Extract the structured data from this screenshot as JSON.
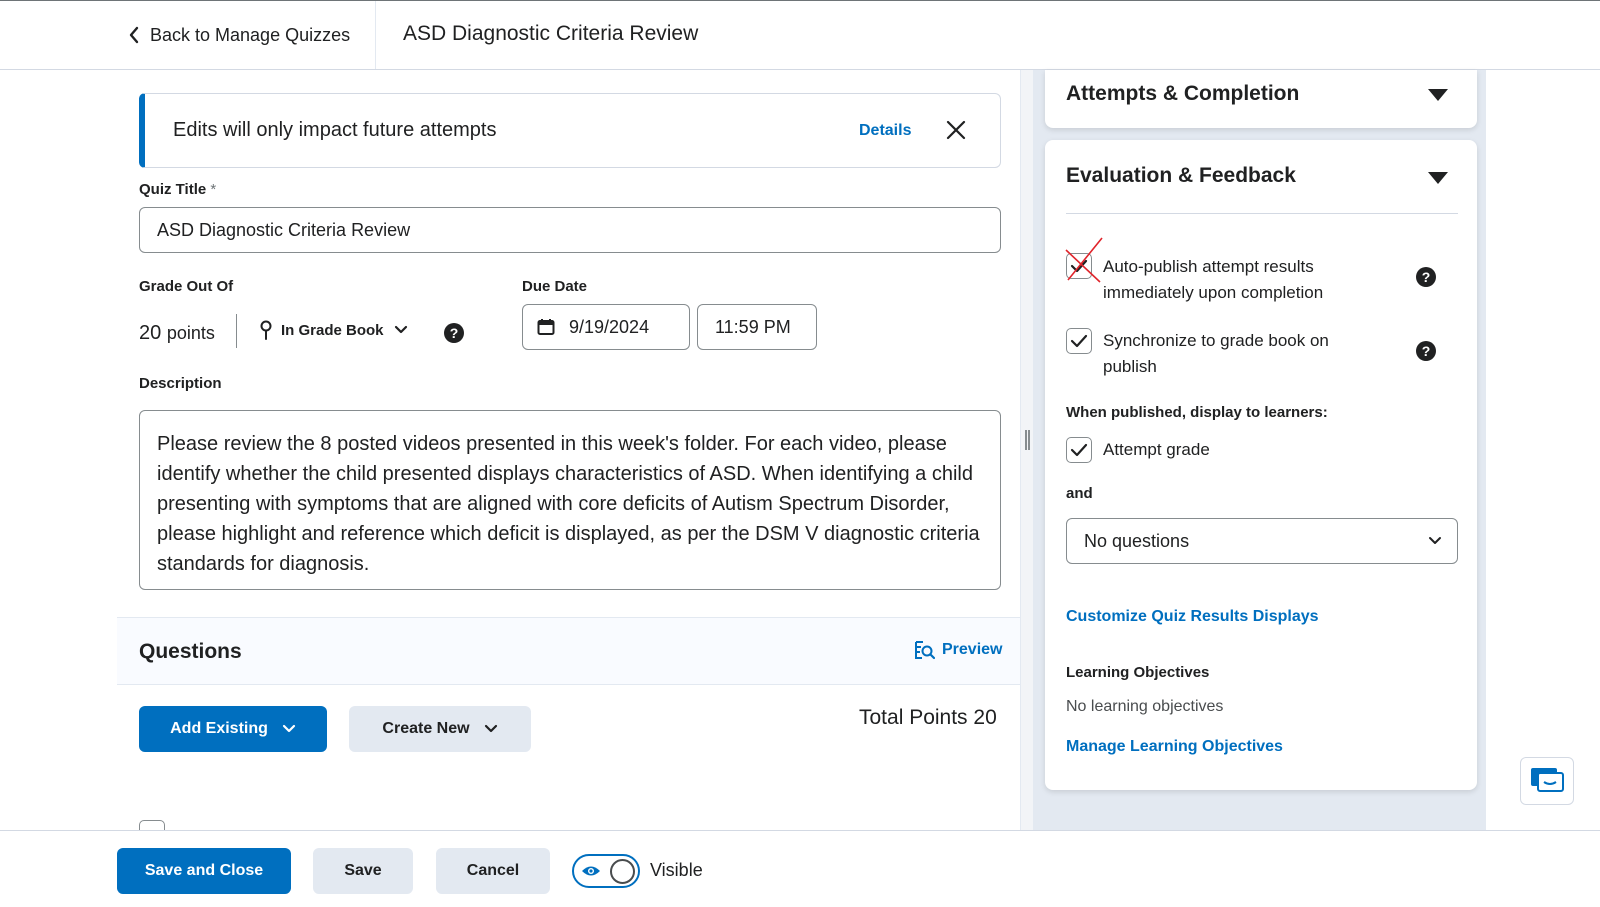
{
  "header": {
    "back_label": "Back to Manage Quizzes",
    "title": "ASD Diagnostic Criteria Review"
  },
  "notice": {
    "text": "Edits will only impact future attempts",
    "details_label": "Details"
  },
  "form": {
    "quiz_title_label": "Quiz Title",
    "required_mark": "*",
    "quiz_title_value": "ASD Diagnostic Criteria Review",
    "grade_label": "Grade Out Of",
    "grade_value": "20",
    "grade_unit": "points",
    "gradebook_label": "In Grade Book",
    "due_date_label": "Due Date",
    "due_date_value": "9/19/2024",
    "due_time_value": "11:59 PM",
    "description_label": "Description",
    "description_value": "Please review the 8 posted videos presented in this week's folder. For each video, please identify whether the child presented displays characteristics of ASD. When identifying a child presenting with symptoms that are aligned with core deficits of Autism Spectrum Disorder, please highlight and reference which deficit is displayed, as per the DSM V diagnostic criteria standards for diagnosis."
  },
  "questions": {
    "title": "Questions",
    "preview_label": "Preview",
    "add_existing_label": "Add Existing",
    "create_new_label": "Create New",
    "total_points_label": "Total Points 20"
  },
  "right_panel": {
    "attempts_title": "Attempts & Completion",
    "evaluation_title": "Evaluation & Feedback",
    "auto_publish_label": "Auto-publish attempt results immediately upon completion",
    "auto_publish_checked": true,
    "sync_label": "Synchronize to grade book on publish",
    "sync_checked": true,
    "display_heading": "When published, display to learners:",
    "attempt_grade_label": "Attempt grade",
    "attempt_grade_checked": true,
    "and_label": "and",
    "questions_select_value": "No questions",
    "customize_link": "Customize Quiz Results Displays",
    "objectives_heading": "Learning Objectives",
    "objectives_empty": "No learning objectives",
    "manage_objectives_link": "Manage Learning Objectives"
  },
  "footer": {
    "save_close_label": "Save and Close",
    "save_label": "Save",
    "cancel_label": "Cancel",
    "visibility_label": "Visible",
    "visible_on": true
  },
  "colors": {
    "accent": "#006fbf",
    "annotation_mark": "#e0242b",
    "panel_bg": "#e3e9f1"
  }
}
